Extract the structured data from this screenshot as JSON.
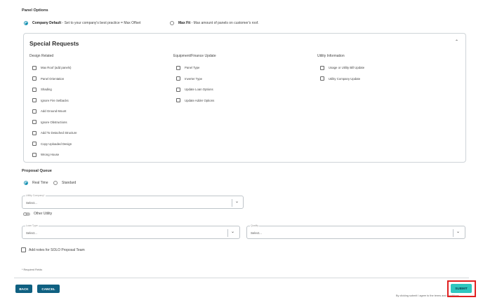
{
  "panel_options": {
    "title": "Panel Options",
    "option_default_name": "Company Default",
    "option_default_desc": " - Set to your company's best practice = Max Offset",
    "option_maxfit_name": "Max Fit",
    "option_maxfit_desc": " - Max amount of panels on customer's roof.",
    "selected": "Company Default"
  },
  "special_requests": {
    "title": "Special Requests",
    "expanded": true,
    "columns": [
      {
        "title": "Design Related",
        "items": [
          "Max Roof (add panels)",
          "Panel Orientation",
          "Shading",
          "Ignore Fire Setbacks",
          "Add Ground Mount",
          "Ignore Obstructions",
          "Add To Detached Structure",
          "Copy Uploaded Design",
          "Wrong House"
        ]
      },
      {
        "title": "Equipment/Finance Update",
        "items": [
          "Panel Type",
          "Inverter Type",
          "Update Loan Options",
          "Update Adder Options"
        ]
      },
      {
        "title": "Utility Information",
        "items": [
          "Usage or Utility Bill Update",
          "Utility Company Update"
        ]
      }
    ]
  },
  "proposal_queue": {
    "title": "Proposal Queue",
    "options": [
      "Real Time",
      "Standard"
    ],
    "selected": "Real Time"
  },
  "utility_company": {
    "label": "Utility Company*",
    "value": "Select..."
  },
  "other_utility": {
    "label": "Other Utility",
    "on": false
  },
  "loan_type": {
    "label": "Loan Type",
    "value": "Select..."
  },
  "quality": {
    "label": "Quality",
    "value": "Select..."
  },
  "notes": {
    "label": "Add notes for SOLO Proposal Team"
  },
  "required_note": "* Required Fields",
  "buttons": {
    "back": "BACK",
    "cancel": "CANCEL",
    "submit": "SUBMIT"
  },
  "footer_terms": "By clicking submit I agree to the terms and conditions",
  "colors": {
    "accent": "#1a94b4",
    "primary_button": "#0f6081",
    "submit_button": "#2fc6bf",
    "highlight": "#e02020"
  },
  "icons": {
    "collapse": "chevron-up-icon",
    "dropdown": "chevron-down-icon"
  }
}
